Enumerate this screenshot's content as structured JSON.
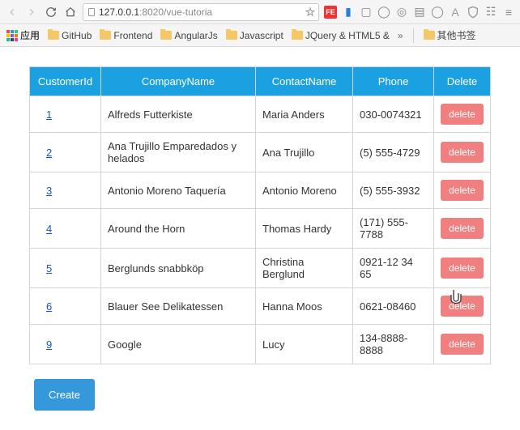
{
  "url": {
    "host": "127.0.0.1",
    "port": ":8020",
    "path": "/vue-tutoria"
  },
  "bookmarks": {
    "apps": "应用",
    "items": [
      "GitHub",
      "Frontend",
      "AngularJs",
      "Javascript",
      "JQuery & HTML5 &"
    ],
    "overflow": "»",
    "other": "其他书签"
  },
  "table": {
    "headers": {
      "id": "CustomerId",
      "company": "CompanyName",
      "contact": "ContactName",
      "phone": "Phone",
      "del": "Delete"
    },
    "rows": [
      {
        "id": "1",
        "company": "Alfreds Futterkiste",
        "contact": "Maria Anders",
        "phone": "030-0074321"
      },
      {
        "id": "2",
        "company": "Ana Trujillo Emparedados y helados",
        "contact": "Ana Trujillo",
        "phone": "(5) 555-4729"
      },
      {
        "id": "3",
        "company": "Antonio Moreno Taquería",
        "contact": "Antonio Moreno",
        "phone": "(5) 555-3932"
      },
      {
        "id": "4",
        "company": "Around the Horn",
        "contact": "Thomas Hardy",
        "phone": "(171) 555-7788"
      },
      {
        "id": "5",
        "company": "Berglunds snabbköp",
        "contact": "Christina Berglund",
        "phone": "0921-12 34 65"
      },
      {
        "id": "6",
        "company": "Blauer See Delikatessen",
        "contact": "Hanna Moos",
        "phone": "0621-08460"
      },
      {
        "id": "9",
        "company": "Google",
        "contact": "Lucy",
        "phone": "134-8888-8888"
      }
    ],
    "deleteLabel": "delete"
  },
  "buttons": {
    "create": "Create"
  }
}
